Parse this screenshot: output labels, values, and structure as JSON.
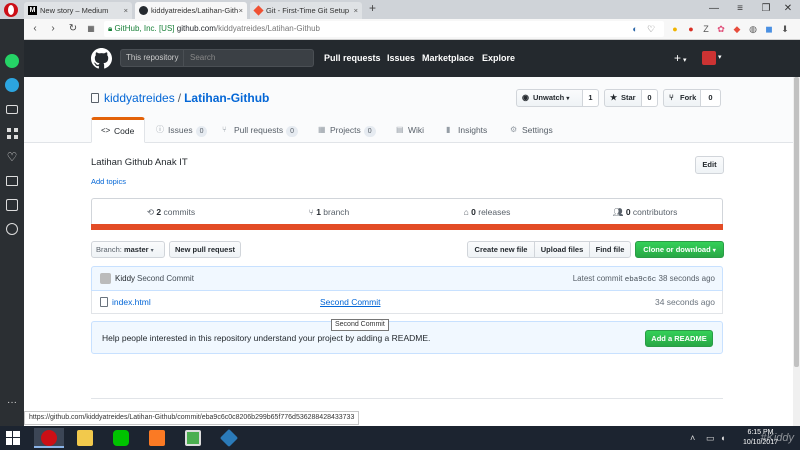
{
  "browser": {
    "tabs": [
      {
        "label": "New story – Medium",
        "active": false
      },
      {
        "label": "kiddyatreides/Latihan-Gith",
        "active": true
      },
      {
        "label": "Git - First-Time Git Setup",
        "active": false
      }
    ],
    "new_tab": "+",
    "address": {
      "security_label": "GitHub, Inc. [US]",
      "url_host": "github.com",
      "url_path": "/kiddyatreides/Latihan-Github"
    },
    "status_url": "https://github.com/kiddyatreides/Latihan-Github/commit/eba9c6c0c8206b299b65f776d536288428433733"
  },
  "github_header": {
    "scope_label": "This repository",
    "search_placeholder": "Search",
    "nav": [
      "Pull requests",
      "Issues",
      "Marketplace",
      "Explore"
    ],
    "plus": "+"
  },
  "repo": {
    "owner": "kiddyatreides",
    "separator": "/",
    "name": "Latihan-Github",
    "unwatch_label": "Unwatch",
    "watch_count": "1",
    "star_label": "Star",
    "star_count": "0",
    "fork_label": "Fork",
    "fork_count": "0",
    "tabs": [
      {
        "label": "Code",
        "count": null,
        "selected": true
      },
      {
        "label": "Issues",
        "count": "0",
        "selected": false
      },
      {
        "label": "Pull requests",
        "count": "0",
        "selected": false
      },
      {
        "label": "Projects",
        "count": "0",
        "selected": false
      },
      {
        "label": "Wiki",
        "count": null,
        "selected": false
      },
      {
        "label": "Insights",
        "count": null,
        "selected": false
      },
      {
        "label": "Settings",
        "count": null,
        "selected": false
      }
    ],
    "description": "Latihan Github Anak IT",
    "add_topics": "Add topics",
    "edit_label": "Edit",
    "numbers": {
      "commits": {
        "count": "2",
        "label": "commits"
      },
      "branches": {
        "count": "1",
        "label": "branch"
      },
      "releases": {
        "count": "0",
        "label": "releases"
      },
      "contributors": {
        "count": "0",
        "label": "contributors"
      }
    },
    "language_color": "#e34c26",
    "branch_prefix": "Branch:",
    "branch_name": "master",
    "new_pr_label": "New pull request",
    "create_file_label": "Create new file",
    "upload_label": "Upload files",
    "find_label": "Find file",
    "clone_label": "Clone or download",
    "commit": {
      "author": "Kiddy",
      "message": "Second Commit",
      "latest_prefix": "Latest commit",
      "sha": "eba9c6c",
      "age": "38 seconds ago"
    },
    "files": [
      {
        "name": "index.html",
        "commit_message": "Second Commit",
        "age": "34 seconds ago"
      }
    ],
    "tooltip": "Second Commit",
    "readme_prompt": "Help people interested in this repository understand your project by adding a README.",
    "add_readme_label": "Add a README"
  },
  "taskbar": {
    "time": "6:15 PM",
    "date": "10/10/2017",
    "watermark": "#Kiddy"
  },
  "colors": {
    "github_header": "#24292e",
    "link": "#0366d6",
    "green_button": "#28a745",
    "selected_tab_accent": "#e36209"
  }
}
